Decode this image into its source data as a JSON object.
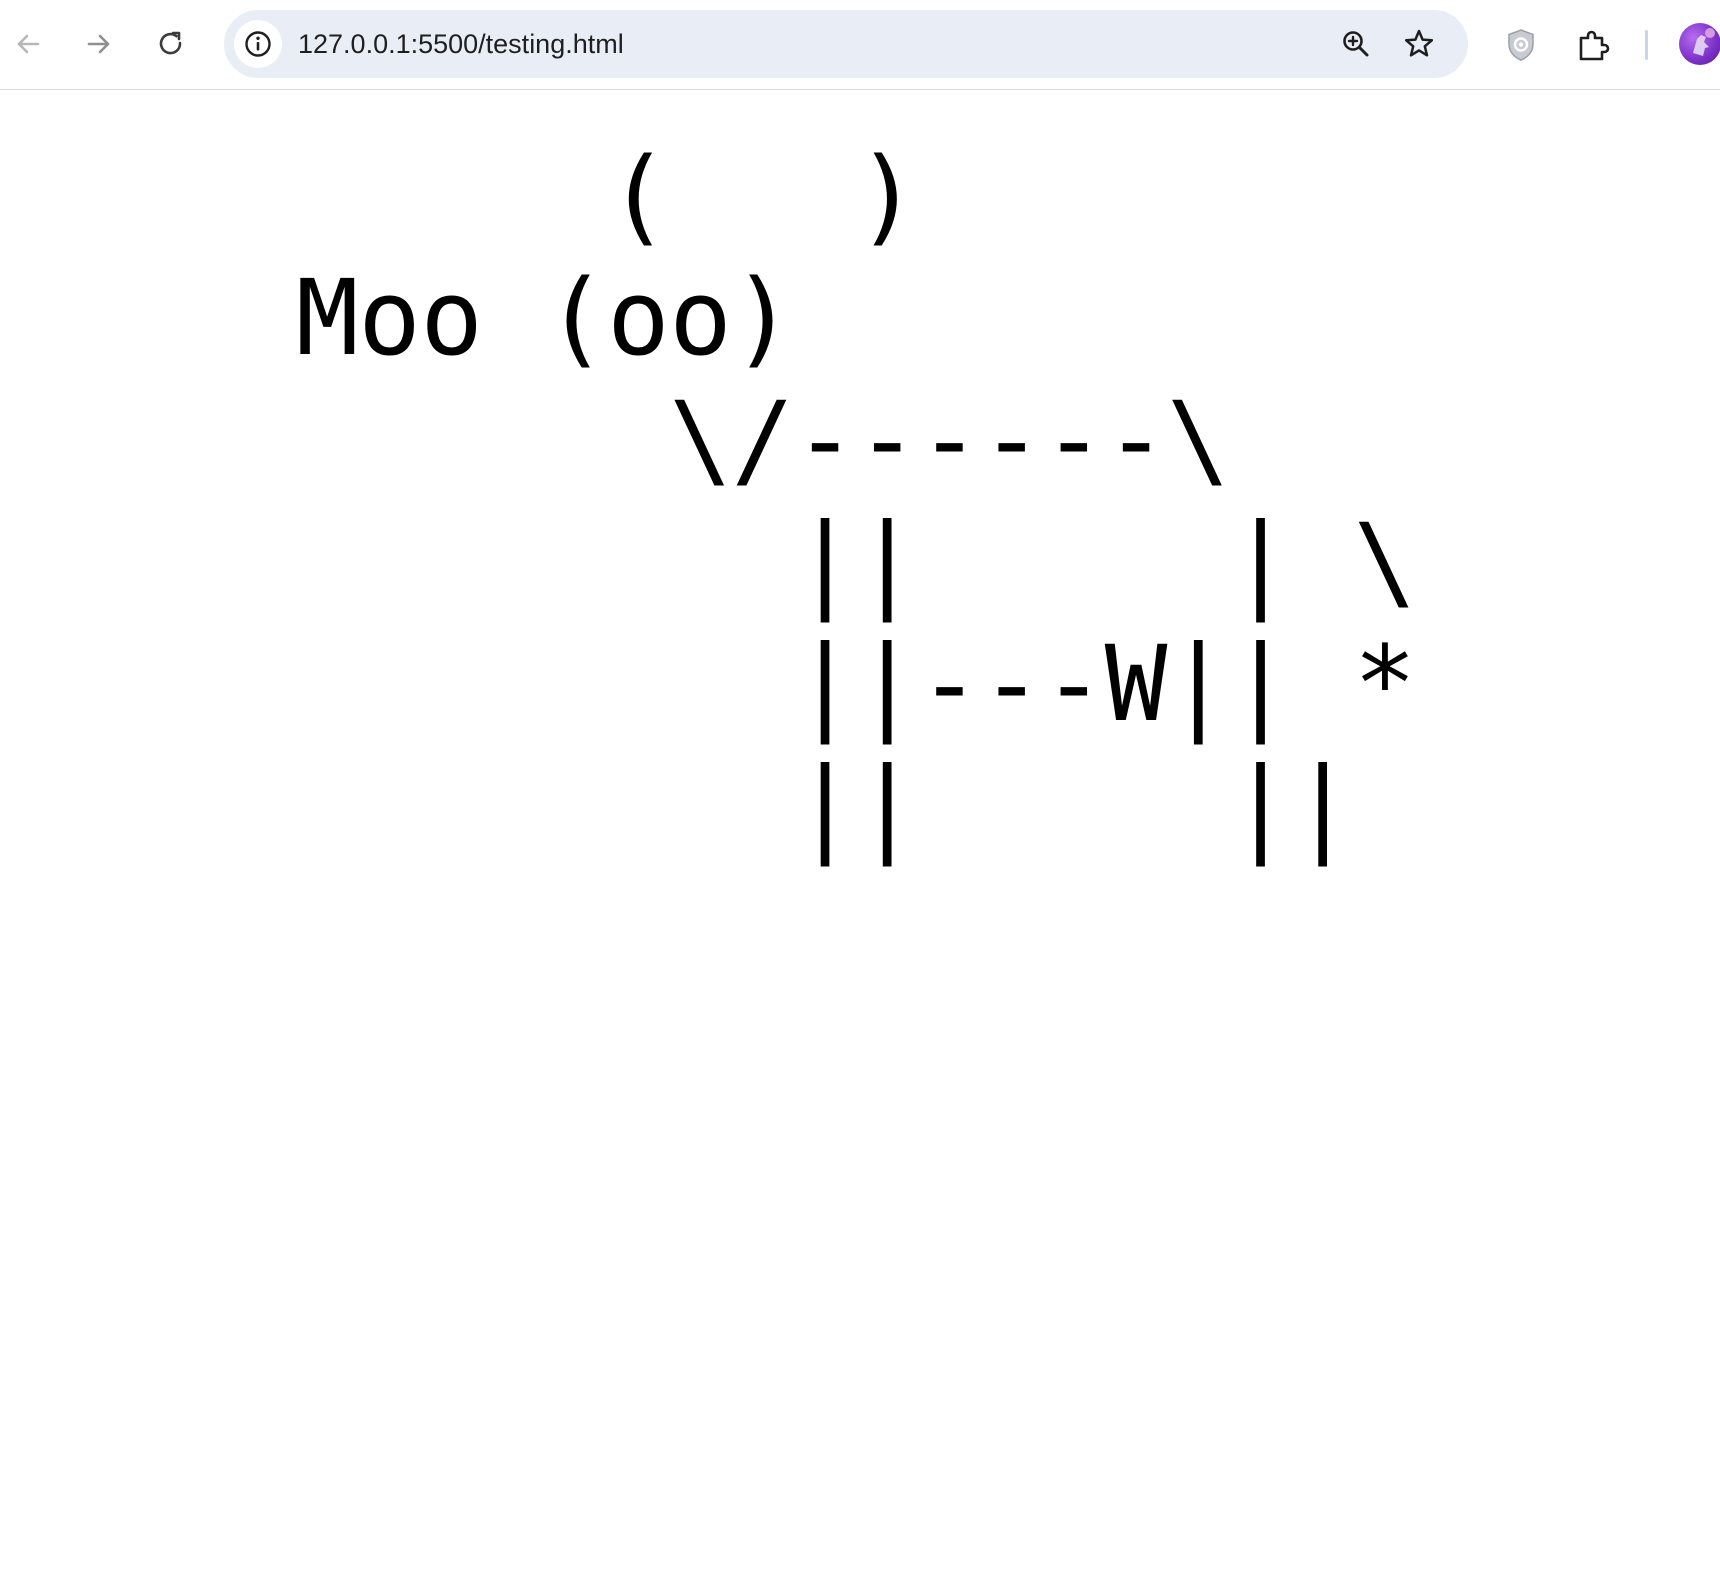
{
  "browser": {
    "url": "127.0.0.1:5500/testing.html",
    "icons": {
      "back": "arrow-left",
      "forward": "arrow-right",
      "reload": "reload",
      "site_info": "info-circle",
      "zoom": "zoom-in",
      "bookmark": "star-outline",
      "extension_shield": "shield",
      "extensions": "puzzle-piece",
      "profile": "avatar"
    }
  },
  "page": {
    "ascii_art": "     (   )\nMoo (oo)\n      \\/------\\\n        ||     | \\\n        ||---W|| *\n        ||     ||"
  }
}
